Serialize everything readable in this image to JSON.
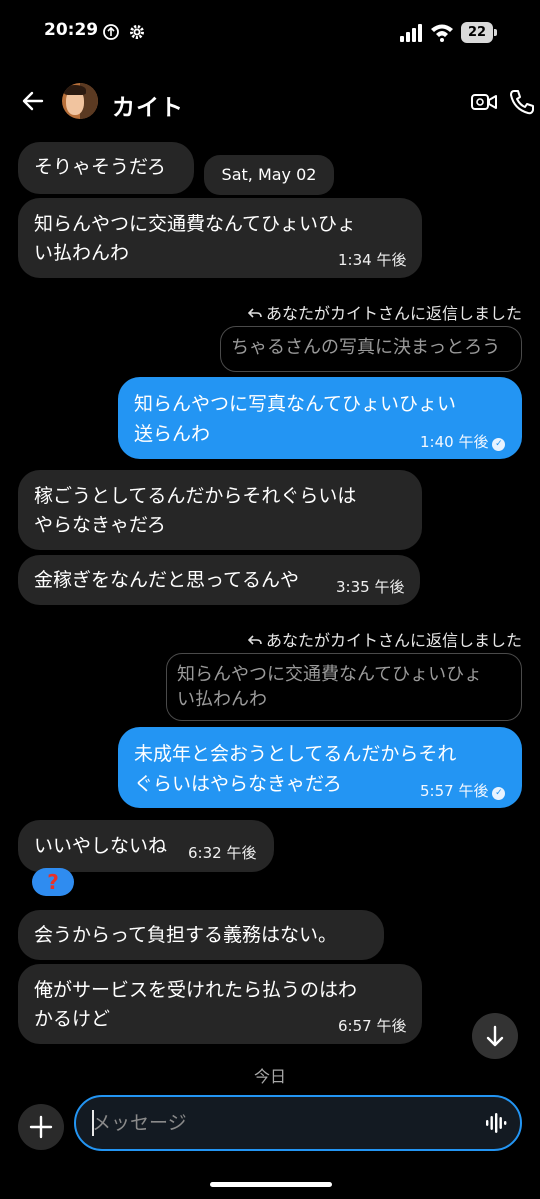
{
  "status_bar": {
    "time": "20:29",
    "battery": "22",
    "icons": [
      "sync-icon",
      "gear-icon",
      "signal-icon",
      "wifi-icon",
      "battery-icon"
    ]
  },
  "header": {
    "contact_name": "カイト",
    "icons": [
      "back-arrow-icon",
      "video-call-icon",
      "phone-icon"
    ]
  },
  "messages": {
    "m1": {
      "text": "そりゃそうだろ"
    },
    "date_pill": "Sat, May 02",
    "m2": {
      "line1": "知らんやつに交通費なんてひょいひょ",
      "line2": "い払わんわ",
      "time": "1:34 午後"
    },
    "reply1": {
      "label": "あなたがカイトさんに返信しました",
      "quote": "ちゃるさんの写真に決まっとろう"
    },
    "m3": {
      "line1": "知らんやつに写真なんてひょいひょい",
      "line2": "送らんわ",
      "time": "1:40 午後"
    },
    "m4": {
      "line1": "稼ごうとしてるんだからそれぐらいは",
      "line2": "やらなきゃだろ"
    },
    "m5": {
      "text": "金稼ぎをなんだと思ってるんや",
      "time": "3:35 午後"
    },
    "reply2": {
      "label": "あなたがカイトさんに返信しました",
      "quote_line1": "知らんやつに交通費なんてひょいひょ",
      "quote_line2": "い払わんわ"
    },
    "m6": {
      "line1": "未成年と会おうとしてるんだからそれ",
      "line2": "ぐらいはやらなきゃだろ",
      "time": "5:57 午後"
    },
    "m7": {
      "text": "いいやしないね",
      "time": "6:32 午後",
      "reaction": "?"
    },
    "m8": {
      "text": "会うからって負担する義務はない。"
    },
    "m9": {
      "line1": "俺がサービスを受けれたら払うのはわ",
      "line2": "かるけど",
      "time": "6:57 午後"
    }
  },
  "today_label": "今日",
  "composer": {
    "placeholder": "メッセージ",
    "value": "",
    "icons": [
      "plus-icon",
      "voice-wave-icon",
      "chevron-down-icon",
      "reply-arrow-icon",
      "read-check-icon"
    ]
  },
  "colors": {
    "background": "#000000",
    "incoming_bubble": "#262626",
    "outgoing_bubble": "#2395f3",
    "accent": "#2395f3"
  }
}
